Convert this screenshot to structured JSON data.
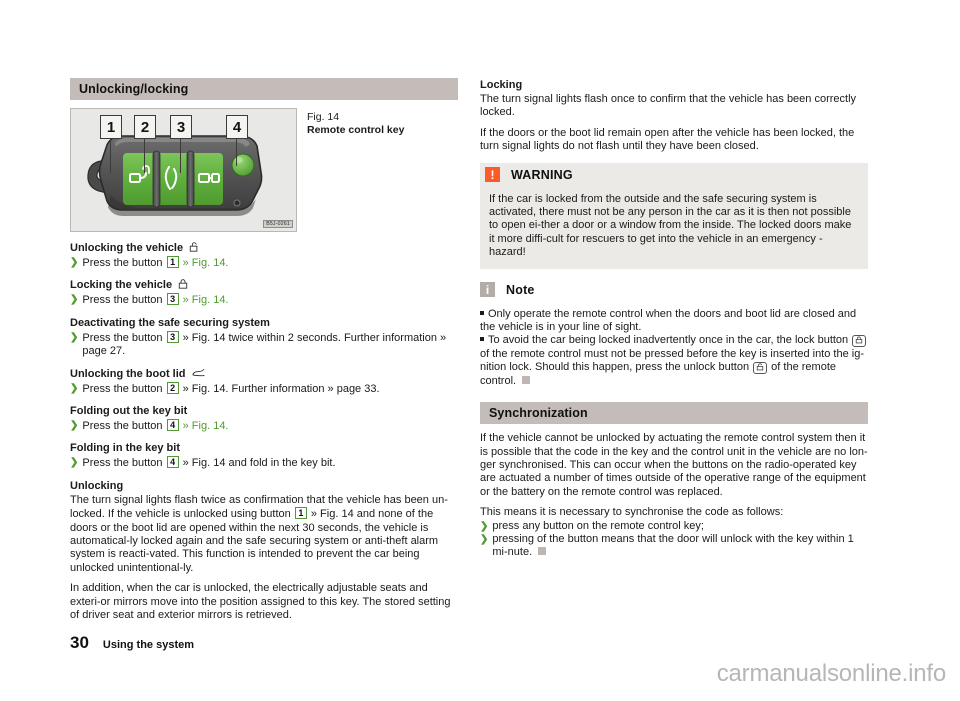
{
  "document": {
    "page_number": "30",
    "footer_label": "Using the system",
    "watermark": "carmanualsonline.info"
  },
  "left": {
    "section_title": "Unlocking/locking",
    "figure": {
      "number": "Fig. 14",
      "caption": "Remote control key",
      "image_code": "B5J-0261",
      "callouts": [
        "1",
        "2",
        "3",
        "4"
      ],
      "alt": "Remote control key with four numbered buttons"
    },
    "blocks": [
      {
        "heading": "Unlocking the vehicle",
        "heading_icon": "unlock-icon",
        "items": [
          {
            "pre": "Press the button ",
            "ref": "1",
            "post": " » Fig. 14."
          }
        ]
      },
      {
        "heading": "Locking the vehicle",
        "heading_icon": "lock-icon",
        "items": [
          {
            "pre": "Press the button ",
            "ref": "3",
            "post": " » Fig. 14."
          }
        ]
      },
      {
        "heading": "Deactivating the safe securing system",
        "heading_icon": "",
        "items": [
          {
            "pre": "Press the button ",
            "ref": "3",
            "post": " » Fig. 14 twice within 2 seconds. Further information » page 27."
          }
        ]
      },
      {
        "heading": "Unlocking the boot lid",
        "heading_icon": "boot-lid-icon",
        "items": [
          {
            "pre": "Press the button ",
            "ref": "2",
            "post": " » Fig. 14. Further information » page 33."
          }
        ]
      },
      {
        "heading": "Folding out the key bit",
        "heading_icon": "",
        "items": [
          {
            "pre": "Press the button ",
            "ref": "4",
            "post": " » Fig. 14."
          }
        ]
      },
      {
        "heading": "Folding in the key bit",
        "heading_icon": "",
        "items": [
          {
            "pre": "Press the button ",
            "ref": "4",
            "post": " » Fig. 14 and fold in the key bit."
          }
        ]
      }
    ],
    "unlocking": {
      "heading": "Unlocking",
      "para1_a": "The turn signal lights flash twice as confirmation that the vehicle has been un-locked. If the vehicle is unlocked using button ",
      "para1_ref": "1",
      "para1_b": " » Fig. 14 and none of the doors or the boot lid are opened within the next 30 seconds, the vehicle is automatical-ly locked again and the safe securing system or anti-theft alarm system is reacti-vated. This function is intended to prevent the car being unlocked unintentional-ly.",
      "para2": "In addition, when the car is unlocked, the electrically adjustable seats and exteri-or mirrors move into the position assigned to this key. The stored setting of driver seat and exterior mirrors is retrieved."
    }
  },
  "right": {
    "locking": {
      "heading": "Locking",
      "para1": "The turn signal lights flash once to confirm that the vehicle has been correctly locked.",
      "para2": "If the doors or the boot lid remain open after the vehicle has been locked, the turn signal lights do not flash until they have been closed."
    },
    "warning": {
      "icon": "warning-icon",
      "title": "WARNING",
      "body": "If the car is locked from the outside and the safe securing system is activated, there must not be any person in the car as it is then not possible to open ei-ther a door or a window from the inside. The locked doors make it more diffi-cult for rescuers to get into the vehicle in an emergency - hazard!"
    },
    "note": {
      "icon": "note-icon",
      "title": "Note",
      "item1": "Only operate the remote control when the doors and boot lid are closed and the vehicle is in your line of sight.",
      "item2_a": "To avoid the car being locked inadvertently once in the car, the lock button ",
      "item2_chip1": "lock-button-icon",
      "item2_b": " of the remote control must not be pressed before the key is inserted into the ig-nition lock. Should this happen, press the unlock button ",
      "item2_chip2": "unlock-button-icon",
      "item2_c": " of the remote control."
    },
    "sync": {
      "section_title": "Synchronization",
      "para1": "If the vehicle cannot be unlocked by actuating the remote control system then it is possible that the code in the key and the control unit in the vehicle are no lon-ger synchronised. This can occur when the buttons on the radio-operated key are actuated a number of times outside of the operative range of the equipment or the battery on the remote control was replaced.",
      "para2": "This means it is necessary to synchronise the code as follows:",
      "steps": [
        "press any button on the remote control key;",
        "pressing of the button means that the door will unlock with the key within 1 mi-nute."
      ]
    }
  },
  "colors": {
    "accent_green": "#4f9b30",
    "bar_grey": "#c4bcb8",
    "warning_orange": "#f95b29",
    "note_grey": "#b4aca8",
    "callout_bg": "#eceae6"
  }
}
